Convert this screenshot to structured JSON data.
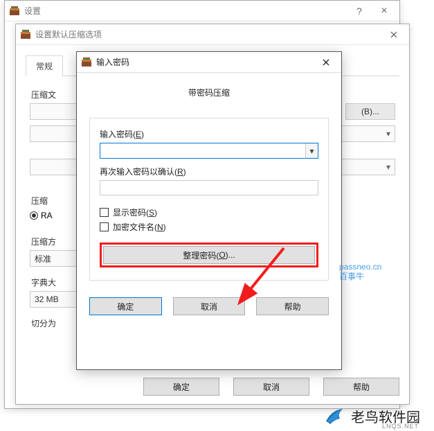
{
  "win1": {
    "title": "设置",
    "help_glyph": "?",
    "close_glyph": "×"
  },
  "win2": {
    "title": "设置默认压缩选项",
    "tab_general": "常规",
    "label_archive_name": "压缩文",
    "browse_btn": "(B)...",
    "label_format": "压缩",
    "radio_rar": "RA",
    "label_method": "压缩方",
    "method_value": "标准",
    "label_dict": "字典大",
    "dict_value": "32 MB",
    "label_split": "切分为",
    "btn_ok": "确定",
    "btn_cancel": "取消",
    "btn_help": "帮助"
  },
  "win3": {
    "title": "输入密码",
    "group_title": "带密码压缩",
    "label_enter": "输入密码(",
    "label_enter_key": "E",
    "label_enter_close": ")",
    "label_reenter": "再次输入密码以确认(",
    "label_reenter_key": "R",
    "label_reenter_close": ")",
    "chk_show": "显示密码(",
    "chk_show_key": "S",
    "chk_show_close": ")",
    "chk_encrypt": "加密文件名(",
    "chk_encrypt_key": "N",
    "chk_encrypt_close": ")",
    "organize_btn": "整理密码(",
    "organize_key": "O",
    "organize_close": ")...",
    "btn_ok": "确定",
    "btn_cancel": "取消",
    "btn_help": "帮助"
  },
  "watermark": {
    "l1": "passneo.cn",
    "l2": "百事牛"
  },
  "footer": {
    "brand": "老鸟软件园",
    "sub": "LNQS.NET"
  }
}
